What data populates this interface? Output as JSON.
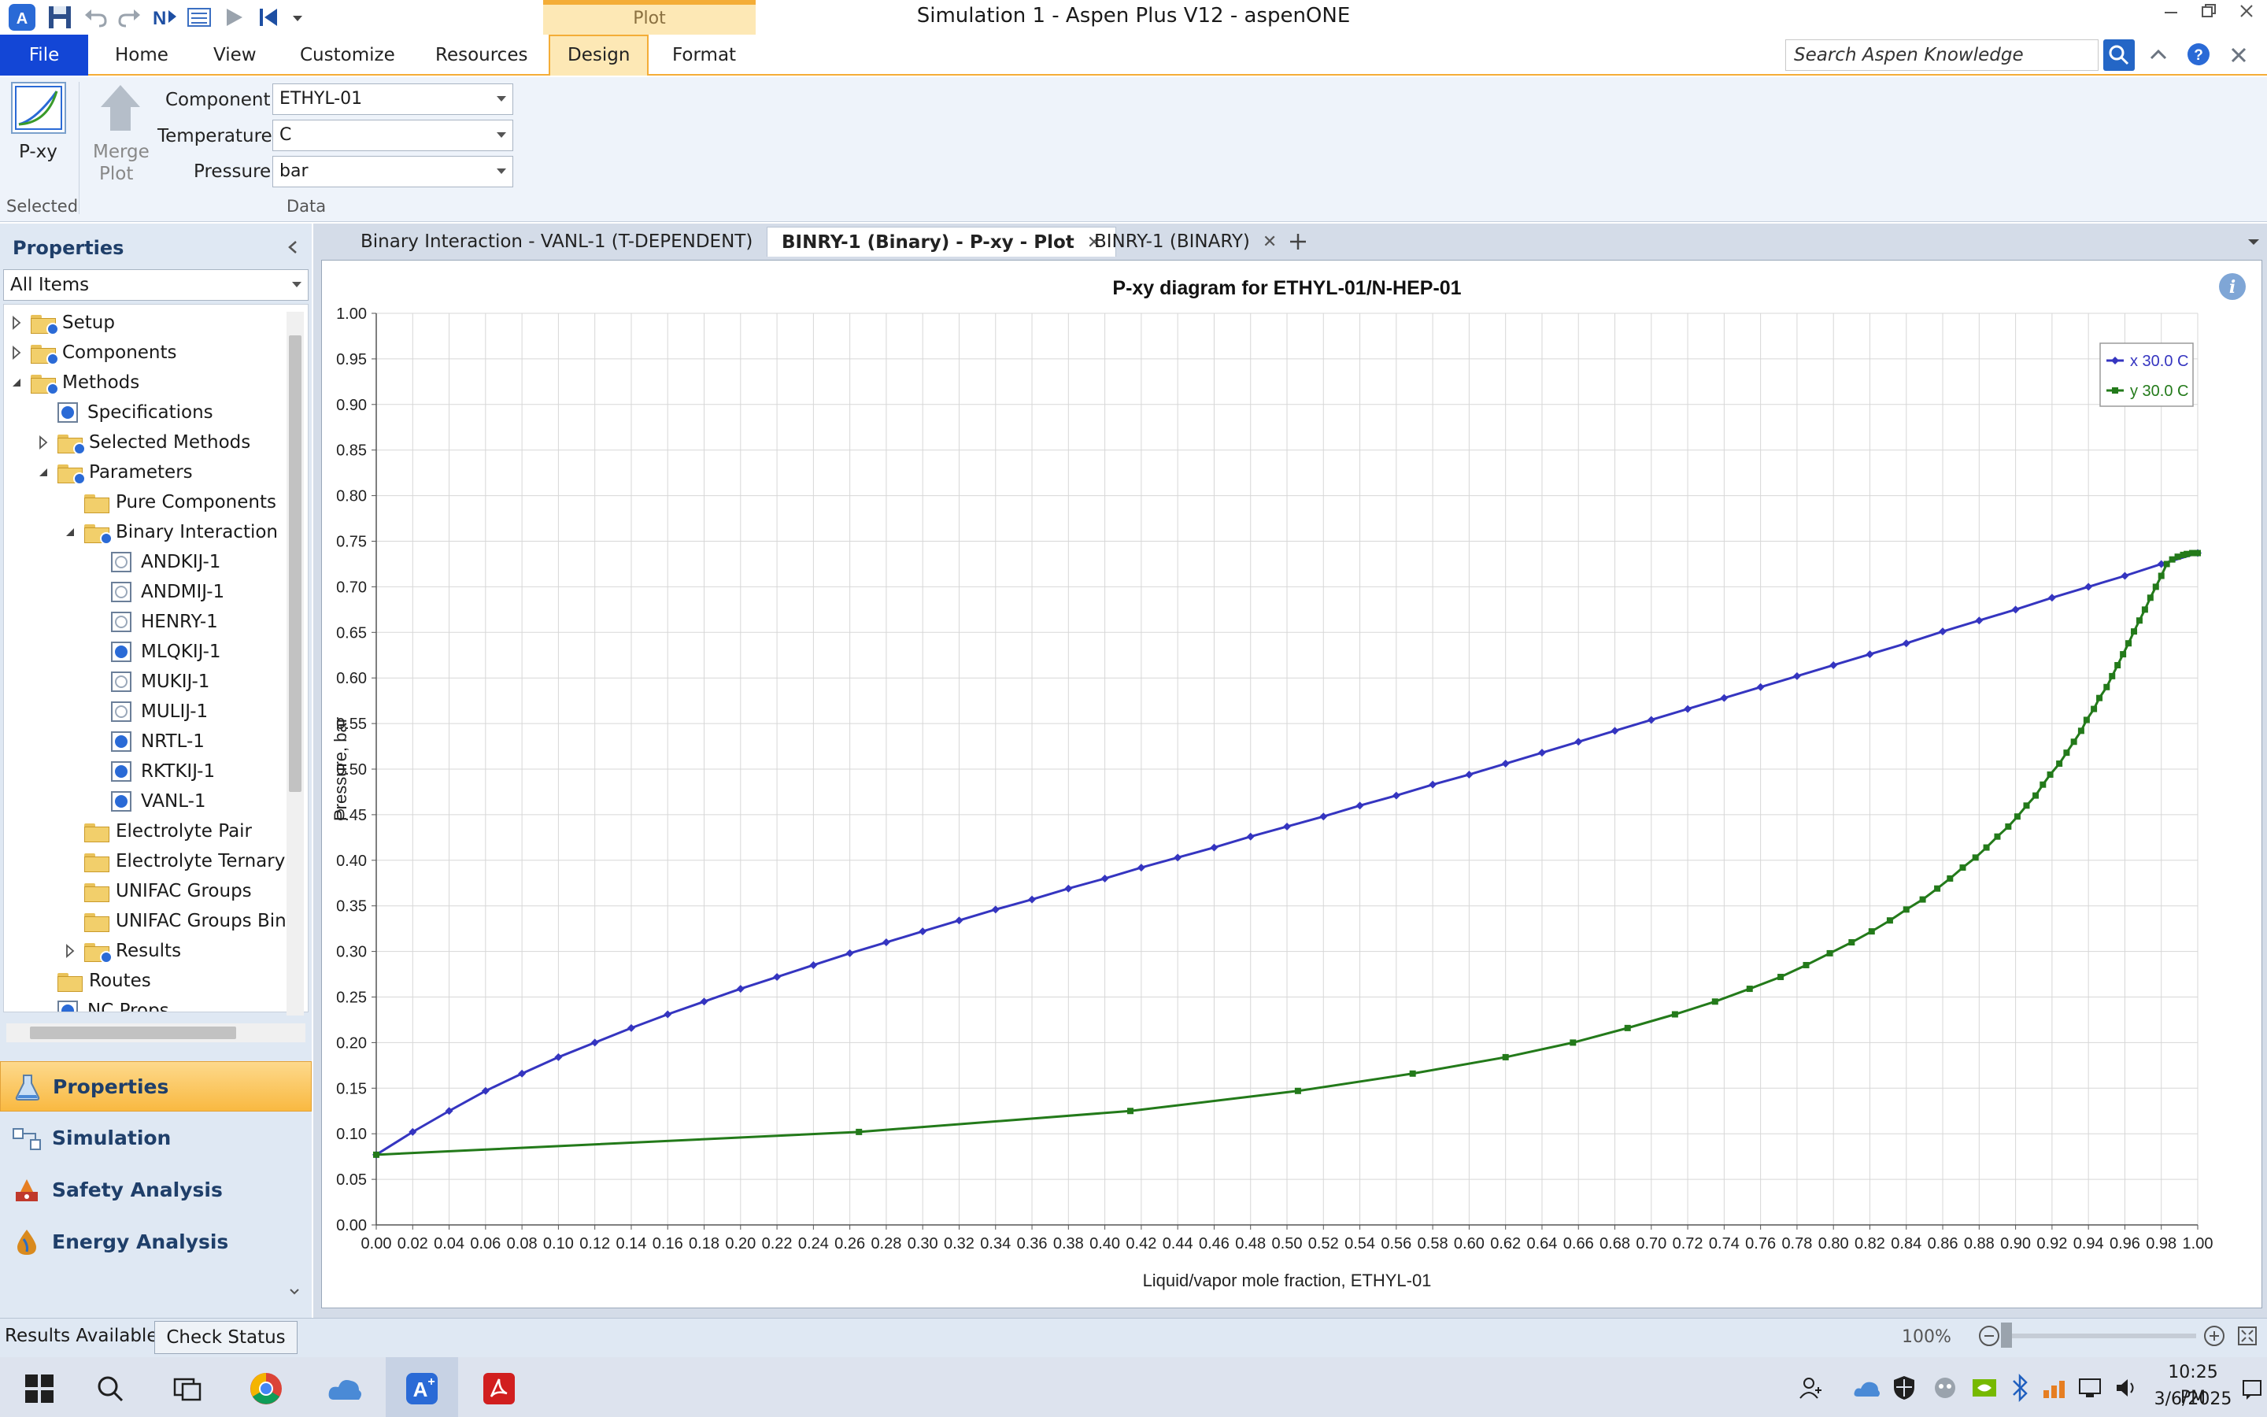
{
  "window": {
    "title": "Simulation 1 - Aspen Plus V12 - aspenONE",
    "context_tab_header": "Plot"
  },
  "ribbon": {
    "tabs": [
      "File",
      "Home",
      "View",
      "Customize",
      "Resources",
      "Design",
      "Format"
    ],
    "active_tab": "Design",
    "search_placeholder": "Search Aspen Knowledge",
    "pxy_label": "P-xy",
    "merge_label_1": "Merge",
    "merge_label_2": "Plot",
    "component_label": "Component",
    "component_value": "ETHYL-01",
    "temperature_label": "Temperature",
    "temperature_value": "C",
    "pressure_label": "Pressure",
    "pressure_value": "bar",
    "group_selected": "Selected",
    "group_data": "Data"
  },
  "sidebar": {
    "header": "Properties",
    "filter": "All Items",
    "tree": [
      {
        "label": "Setup",
        "level": 0,
        "exp": "right",
        "icon": "folder-check"
      },
      {
        "label": "Components",
        "level": 0,
        "exp": "right",
        "icon": "folder-check"
      },
      {
        "label": "Methods",
        "level": 0,
        "exp": "down",
        "icon": "folder-check"
      },
      {
        "label": "Specifications",
        "level": 1,
        "exp": "",
        "icon": "form-done"
      },
      {
        "label": "Selected Methods",
        "level": 1,
        "exp": "right",
        "icon": "folder-check"
      },
      {
        "label": "Parameters",
        "level": 1,
        "exp": "down",
        "icon": "folder-check"
      },
      {
        "label": "Pure Components",
        "level": 2,
        "exp": "",
        "icon": "folder"
      },
      {
        "label": "Binary Interaction",
        "level": 2,
        "exp": "down",
        "icon": "folder-check"
      },
      {
        "label": "ANDKIJ-1",
        "level": 3,
        "exp": "",
        "icon": "form"
      },
      {
        "label": "ANDMIJ-1",
        "level": 3,
        "exp": "",
        "icon": "form"
      },
      {
        "label": "HENRY-1",
        "level": 3,
        "exp": "",
        "icon": "form"
      },
      {
        "label": "MLQKIJ-1",
        "level": 3,
        "exp": "",
        "icon": "form-done"
      },
      {
        "label": "MUKIJ-1",
        "level": 3,
        "exp": "",
        "icon": "form"
      },
      {
        "label": "MULIJ-1",
        "level": 3,
        "exp": "",
        "icon": "form"
      },
      {
        "label": "NRTL-1",
        "level": 3,
        "exp": "",
        "icon": "form-done"
      },
      {
        "label": "RKTKIJ-1",
        "level": 3,
        "exp": "",
        "icon": "form-done"
      },
      {
        "label": "VANL-1",
        "level": 3,
        "exp": "",
        "icon": "form-done"
      },
      {
        "label": "Electrolyte Pair",
        "level": 2,
        "exp": "",
        "icon": "folder"
      },
      {
        "label": "Electrolyte Ternary",
        "level": 2,
        "exp": "",
        "icon": "folder"
      },
      {
        "label": "UNIFAC Groups",
        "level": 2,
        "exp": "",
        "icon": "folder"
      },
      {
        "label": "UNIFAC Groups Bin",
        "level": 2,
        "exp": "",
        "icon": "folder"
      },
      {
        "label": "Results",
        "level": 2,
        "exp": "right",
        "icon": "folder-check"
      },
      {
        "label": "Routes",
        "level": 1,
        "exp": "",
        "icon": "folder"
      },
      {
        "label": "NC Props",
        "level": 1,
        "exp": "",
        "icon": "form-done"
      }
    ],
    "nav": [
      "Properties",
      "Simulation",
      "Safety Analysis",
      "Energy Analysis"
    ]
  },
  "doc_tabs": [
    {
      "label": "Binary Interaction - VANL-1 (T-DEPENDENT)",
      "active": false
    },
    {
      "label": "BINRY-1 (Binary) - P-xy - Plot",
      "active": true
    },
    {
      "label": "BINRY-1 (BINARY)",
      "active": false
    }
  ],
  "status": {
    "results": "Results Available",
    "check_status": "Check Status",
    "zoom": "100%"
  },
  "taskbar": {
    "time": "10:25 PM",
    "date": "3/6/2025"
  },
  "colors": {
    "series_x": "#3535c0",
    "series_y": "#237a1a",
    "accent": "#f4ad37",
    "file_tab": "#1346d6"
  },
  "chart_data": {
    "type": "line",
    "title": "P-xy diagram for ETHYL-01/N-HEP-01",
    "xlabel": "Liquid/vapor mole fraction, ETHYL-01",
    "ylabel": "Pressure, bar",
    "xlim": [
      0,
      1
    ],
    "ylim": [
      0,
      1
    ],
    "x_ticks": [
      "0.00",
      "0.02",
      "0.04",
      "0.06",
      "0.08",
      "0.10",
      "0.12",
      "0.14",
      "0.16",
      "0.18",
      "0.20",
      "0.22",
      "0.24",
      "0.26",
      "0.28",
      "0.30",
      "0.32",
      "0.34",
      "0.36",
      "0.38",
      "0.40",
      "0.42",
      "0.44",
      "0.46",
      "0.48",
      "0.50",
      "0.52",
      "0.54",
      "0.56",
      "0.58",
      "0.60",
      "0.62",
      "0.64",
      "0.66",
      "0.68",
      "0.70",
      "0.72",
      "0.74",
      "0.76",
      "0.78",
      "0.80",
      "0.82",
      "0.84",
      "0.86",
      "0.88",
      "0.90",
      "0.92",
      "0.94",
      "0.96",
      "0.98",
      "1.00"
    ],
    "y_ticks": [
      "0.00",
      "0.05",
      "0.10",
      "0.15",
      "0.20",
      "0.25",
      "0.30",
      "0.35",
      "0.40",
      "0.45",
      "0.50",
      "0.55",
      "0.60",
      "0.65",
      "0.70",
      "0.75",
      "0.80",
      "0.85",
      "0.90",
      "0.95",
      "1.00"
    ],
    "grid": true,
    "legend_position": "top-right",
    "series": [
      {
        "name": "x 30.0 C",
        "marker": "diamond",
        "x": [
          0.0,
          0.02,
          0.04,
          0.06,
          0.08,
          0.1,
          0.12,
          0.14,
          0.16,
          0.18,
          0.2,
          0.22,
          0.24,
          0.26,
          0.28,
          0.3,
          0.32,
          0.34,
          0.36,
          0.38,
          0.4,
          0.42,
          0.44,
          0.46,
          0.48,
          0.5,
          0.52,
          0.54,
          0.56,
          0.58,
          0.6,
          0.62,
          0.64,
          0.66,
          0.68,
          0.7,
          0.72,
          0.74,
          0.76,
          0.78,
          0.8,
          0.82,
          0.84,
          0.86,
          0.88,
          0.9,
          0.92,
          0.94,
          0.96,
          0.98,
          1.0
        ],
        "y": [
          0.077,
          0.102,
          0.125,
          0.147,
          0.166,
          0.184,
          0.2,
          0.216,
          0.231,
          0.245,
          0.259,
          0.272,
          0.285,
          0.298,
          0.31,
          0.322,
          0.334,
          0.346,
          0.357,
          0.369,
          0.38,
          0.392,
          0.403,
          0.414,
          0.426,
          0.437,
          0.448,
          0.46,
          0.471,
          0.483,
          0.494,
          0.506,
          0.518,
          0.53,
          0.542,
          0.554,
          0.566,
          0.578,
          0.59,
          0.602,
          0.614,
          0.626,
          0.638,
          0.651,
          0.663,
          0.675,
          0.688,
          0.7,
          0.712,
          0.725,
          0.737
        ]
      },
      {
        "name": "y 30.0 C",
        "marker": "square",
        "x": [
          0.0,
          0.265,
          0.414,
          0.506,
          0.569,
          0.62,
          0.657,
          0.687,
          0.713,
          0.735,
          0.754,
          0.771,
          0.785,
          0.798,
          0.81,
          0.821,
          0.831,
          0.84,
          0.849,
          0.857,
          0.864,
          0.871,
          0.878,
          0.884,
          0.89,
          0.896,
          0.901,
          0.906,
          0.911,
          0.915,
          0.919,
          0.924,
          0.928,
          0.932,
          0.936,
          0.939,
          0.943,
          0.946,
          0.95,
          0.953,
          0.956,
          0.959,
          0.962,
          0.965,
          0.968,
          0.971,
          0.974,
          0.977,
          0.98,
          0.983,
          0.986,
          0.989,
          0.992,
          0.994,
          0.997,
          1.0
        ],
        "y": [
          0.077,
          0.102,
          0.125,
          0.147,
          0.166,
          0.184,
          0.2,
          0.216,
          0.231,
          0.245,
          0.259,
          0.272,
          0.285,
          0.298,
          0.31,
          0.322,
          0.334,
          0.346,
          0.357,
          0.369,
          0.38,
          0.392,
          0.403,
          0.414,
          0.426,
          0.437,
          0.448,
          0.46,
          0.471,
          0.483,
          0.494,
          0.506,
          0.518,
          0.53,
          0.542,
          0.554,
          0.566,
          0.578,
          0.59,
          0.602,
          0.614,
          0.626,
          0.638,
          0.651,
          0.663,
          0.675,
          0.688,
          0.7,
          0.712,
          0.725,
          0.73,
          0.733,
          0.735,
          0.736,
          0.737,
          0.737
        ]
      }
    ]
  }
}
